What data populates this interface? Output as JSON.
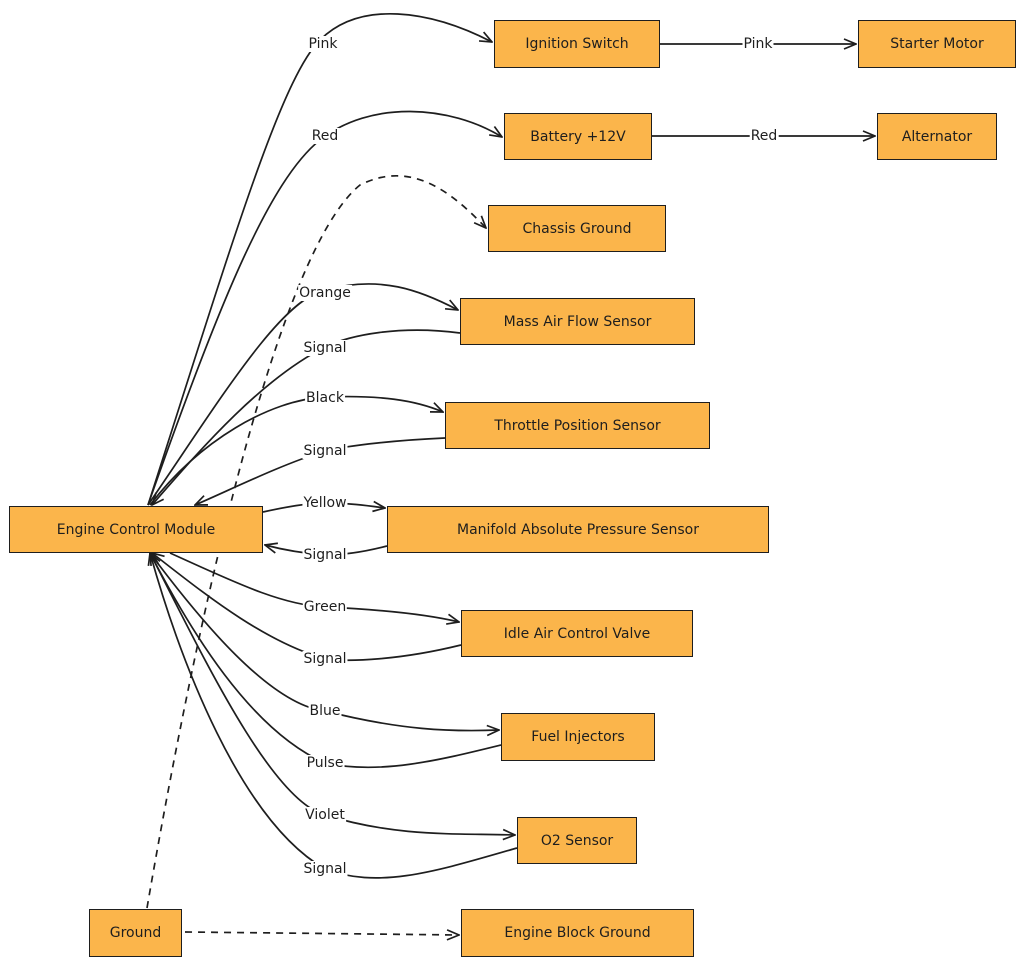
{
  "nodes": {
    "ecm": "Engine Control Module",
    "ignition": "Ignition Switch",
    "starter": "Starter Motor",
    "battery": "Battery +12V",
    "alternator": "Alternator",
    "chassis": "Chassis Ground",
    "maf": "Mass Air Flow Sensor",
    "tps": "Throttle Position Sensor",
    "map": "Manifold Absolute Pressure Sensor",
    "iacv": "Idle Air Control Valve",
    "injectors": "Fuel Injectors",
    "o2": "O2 Sensor",
    "ground": "Ground",
    "block": "Engine Block Ground"
  },
  "edges": {
    "pink1": "Pink",
    "red1": "Red",
    "orange": "Orange",
    "maf_signal": "Signal",
    "black": "Black",
    "tps_signal": "Signal",
    "yellow": "Yellow",
    "map_signal": "Signal",
    "green": "Green",
    "iacv_signal": "Signal",
    "blue": "Blue",
    "pulse": "Pulse",
    "violet": "Violet",
    "o2_signal": "Signal",
    "pink2": "Pink",
    "red2": "Red"
  },
  "colors": {
    "node_fill": "#fbb54b",
    "stroke": "#1e1e1e"
  }
}
